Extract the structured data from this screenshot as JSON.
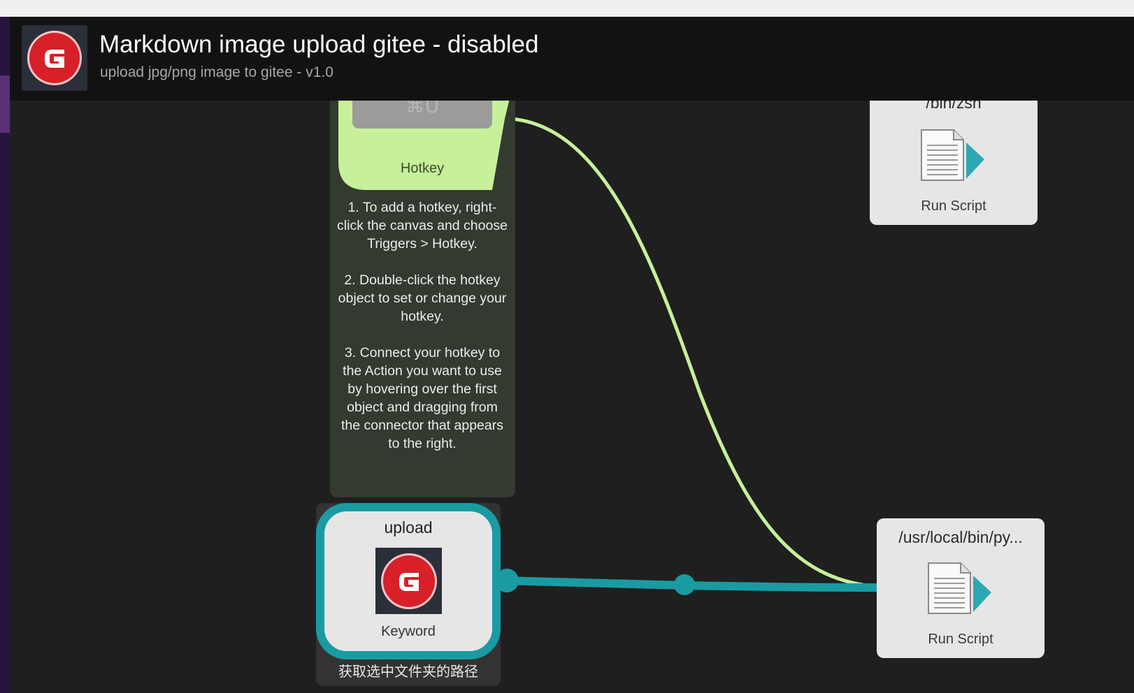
{
  "header": {
    "title": "Markdown image upload gitee - disabled",
    "subtitle": "upload jpg/png image to gitee - v1.0"
  },
  "hotkey": {
    "key_glyph": "⌘U",
    "label": "Hotkey",
    "note_paragraphs": [
      "1. To add a hotkey, right-click the canvas and choose Triggers > Hotkey.",
      "2. Double-click the hotkey object to set or change your hotkey.",
      "3. Connect your hotkey to the Action you want to use by hovering over the first object and dragging from the connector that appears to the right."
    ]
  },
  "run_script_top": {
    "title": "/bin/zsh",
    "label": "Run Script"
  },
  "run_script_bottom": {
    "title": "/usr/local/bin/py...",
    "label": "Run Script"
  },
  "keyword": {
    "title": "upload",
    "label": "Keyword",
    "subtitle": "获取选中文件夹的路径"
  },
  "colors": {
    "hotkey_green": "#c6f09a",
    "keyword_teal": "#1a9ba2",
    "canvas": "#1f1f1f",
    "header": "#121212"
  }
}
